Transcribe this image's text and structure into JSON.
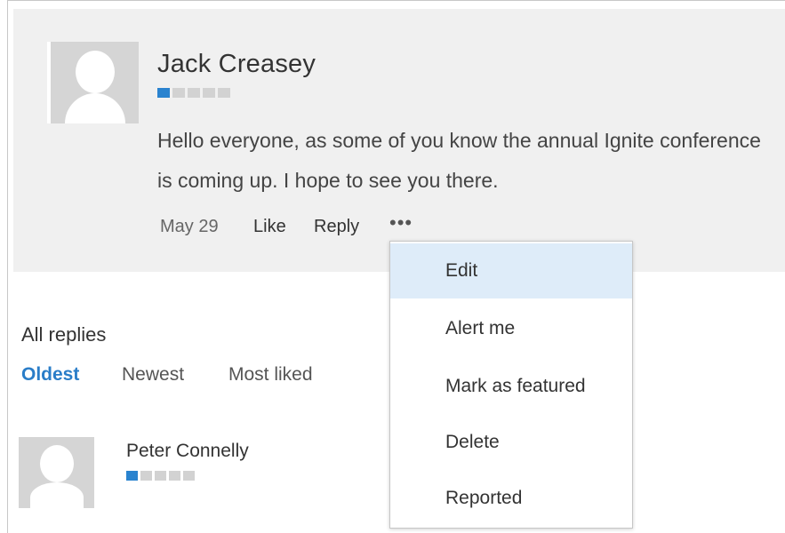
{
  "post": {
    "author": "Jack Creasey",
    "rank_level": 1,
    "rank_total": 5,
    "text": "Hello everyone, as some of you know the annual Ignite conference is coming up.  I hope to see you there.",
    "date": "May 29",
    "like_label": "Like",
    "reply_label": "Reply",
    "more_label": "•••"
  },
  "menu": {
    "items": [
      {
        "label": "Edit",
        "highlighted": true
      },
      {
        "label": "Alert me",
        "highlighted": false
      },
      {
        "label": "Mark as featured",
        "highlighted": false
      },
      {
        "label": "Delete",
        "highlighted": false
      },
      {
        "label": "Reported",
        "highlighted": false
      }
    ]
  },
  "replies": {
    "title": "All replies",
    "sort": {
      "oldest": "Oldest",
      "newest": "Newest",
      "most_liked": "Most liked",
      "active": "Oldest"
    },
    "items": [
      {
        "author": "Peter Connelly",
        "rank_level": 1,
        "rank_total": 5
      }
    ]
  },
  "colors": {
    "accent": "#2a7dc8",
    "rank_on": "#2a83cf",
    "rank_off": "#d2d2d2",
    "post_bg": "#f0f0f0",
    "menu_highlight": "#deecf9"
  },
  "icons": {
    "avatar": "person-placeholder-icon",
    "more": "more-options-icon"
  }
}
